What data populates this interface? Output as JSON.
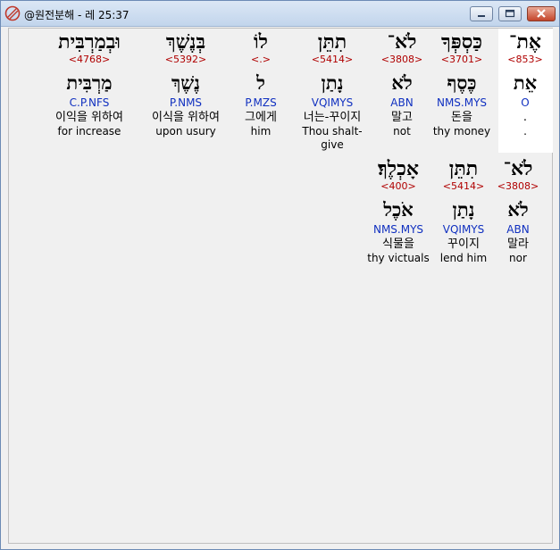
{
  "window": {
    "title": "@원전분해 - 레 25:37"
  },
  "words": [
    {
      "hebrew": "אֶת־",
      "strong": "<853>",
      "lemma": "אֵת",
      "parse": "O",
      "korean": ".",
      "english": "."
    },
    {
      "hebrew": "כַּסְפְּךָ",
      "strong": "<3701>",
      "lemma": "כֶּסֶף",
      "parse": "NMS.MYS",
      "korean": "돈을",
      "english": "thy money"
    },
    {
      "hebrew": "לֹא־",
      "strong": "<3808>",
      "lemma": "לֹא",
      "parse": "ABN",
      "korean": "말고",
      "english": "not"
    },
    {
      "hebrew": "תִתֵּן",
      "strong": "<5414>",
      "lemma": "נָתַן",
      "parse": "VQIMYS",
      "korean": "너는-꾸이지",
      "english": "Thou shalt-give"
    },
    {
      "hebrew": "לוֹ",
      "strong": "<.>",
      "lemma": "ל",
      "parse": "P.MZS",
      "korean": "그에게",
      "english": "him"
    },
    {
      "hebrew": "בְּנֶשֶׁךְ",
      "strong": "<5392>",
      "lemma": "נֶשֶׁךְ",
      "parse": "P.NMS",
      "korean": "이식을 위하여",
      "english": "upon usury"
    },
    {
      "hebrew": "וּבְמַרְבִּית",
      "strong": "<4768>",
      "lemma": "מַרְבִּית",
      "parse": "C.P.NFS",
      "korean": "이익을 위하여",
      "english": "for increase"
    },
    {
      "hebrew": "לֹא־",
      "strong": "<3808>",
      "lemma": "לֹא",
      "parse": "ABN",
      "korean": "말라",
      "english": "nor"
    },
    {
      "hebrew": "תִתֵּן",
      "strong": "<5414>",
      "lemma": "נָתַן",
      "parse": "VQIMYS",
      "korean": "꾸이지",
      "english": "lend him"
    },
    {
      "hebrew": "אָכְלֶךָ׃",
      "strong": "<400>",
      "lemma": "אֹכֶל",
      "parse": "NMS.MYS",
      "korean": "식물을",
      "english": "thy victuals"
    }
  ]
}
